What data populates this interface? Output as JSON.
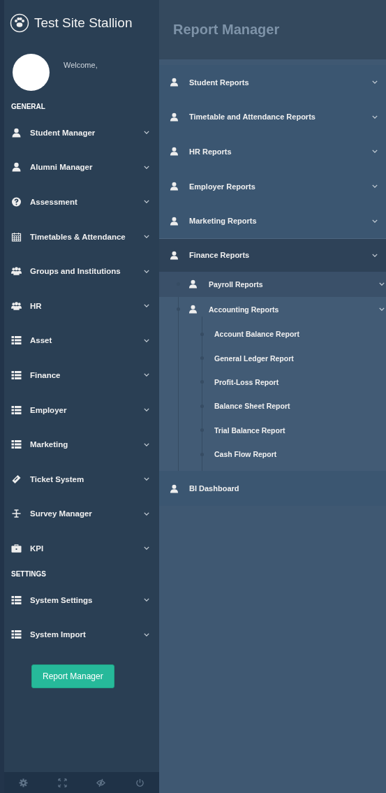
{
  "brand": {
    "title": "Test Site Stallion"
  },
  "profile": {
    "greeting": "Welcome,"
  },
  "sidebar": {
    "sections": [
      {
        "heading": "GENERAL",
        "items": [
          {
            "label": "Student Manager",
            "kind": "user"
          },
          {
            "label": "Alumni Manager",
            "kind": "user"
          },
          {
            "label": "Assessment",
            "kind": "help"
          },
          {
            "label": "Timetables & Attendance",
            "kind": "calendar"
          },
          {
            "label": "Groups and Institutions",
            "kind": "group"
          },
          {
            "label": "HR",
            "kind": "group"
          },
          {
            "label": "Asset",
            "kind": "list"
          },
          {
            "label": "Finance",
            "kind": "list"
          },
          {
            "label": "Employer",
            "kind": "list"
          },
          {
            "label": "Marketing",
            "kind": "list"
          },
          {
            "label": "Ticket System",
            "kind": "ticket"
          },
          {
            "label": "Survey Manager",
            "kind": "survey"
          },
          {
            "label": "KPI",
            "kind": "briefcase"
          }
        ]
      },
      {
        "heading": "SETTINGS",
        "items": [
          {
            "label": "System Settings",
            "kind": "list"
          },
          {
            "label": "System Import",
            "kind": "list"
          }
        ]
      }
    ],
    "button": "Report Manager"
  },
  "page": {
    "title": "Report Manager"
  },
  "reports": [
    {
      "label": "Student Reports",
      "selected": false
    },
    {
      "label": "Timetable and Attendance Reports",
      "selected": false
    },
    {
      "label": "HR Reports",
      "selected": false
    },
    {
      "label": "Employer Reports",
      "selected": false
    },
    {
      "label": "Marketing Reports",
      "selected": false
    },
    {
      "label": "Finance Reports",
      "selected": true,
      "children": [
        {
          "label": "Payroll Reports"
        },
        {
          "label": "Accounting Reports",
          "children": [
            {
              "label": "Account Balance Report"
            },
            {
              "label": "General Ledger Report"
            },
            {
              "label": "Profit-Loss Report"
            },
            {
              "label": "Balance Sheet Report"
            },
            {
              "label": "Trial Balance Report"
            },
            {
              "label": "Cash Flow Report"
            }
          ]
        }
      ]
    },
    {
      "label": "BI Dashboard",
      "selected": false,
      "chevron": false
    }
  ]
}
